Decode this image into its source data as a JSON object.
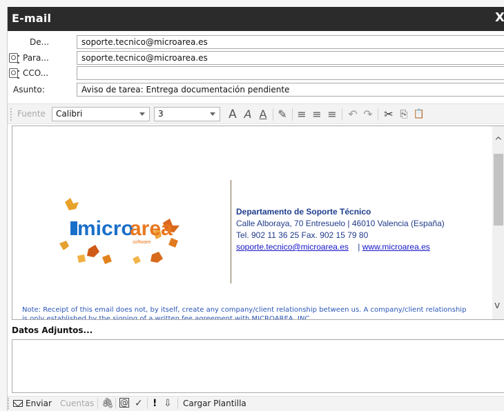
{
  "window": {
    "title": "E-mail",
    "close_glyph": "X"
  },
  "header": {
    "from": {
      "label": "De...",
      "value": "soporte.tecnico@microarea.es"
    },
    "to": {
      "label": "Para...",
      "value": "soporte.tecnico@microarea.es",
      "icon": "address-book-icon"
    },
    "bcc": {
      "label": "CCO...",
      "value": "",
      "icon": "address-book-icon"
    },
    "subject": {
      "label": "Asunto:",
      "value": "Aviso de tarea: Entrega documentación pendiente"
    }
  },
  "toolbar": {
    "font_label": "Fuente",
    "font_name": "Calibri",
    "font_size": "3",
    "glyphs": {
      "font_grow": "A",
      "font_italic": "A",
      "font_outline": "A",
      "highlighter": "✎",
      "align_left": "≡",
      "align_center": "≡",
      "align_right": "≡",
      "undo": "↶",
      "redo": "↷",
      "cut": "✂",
      "copy": "⎘",
      "paste": "📋"
    }
  },
  "body": {
    "logo_text": "microarea",
    "logo_sub": "software",
    "signature": {
      "department": "Departamento de Soporte Técnico",
      "address": "Calle Alboraya, 70 Entresuelo | 46010 Valencia (España)",
      "phone": "Tel. 902 11 36 25 Fax. 902 15 79 80",
      "email": "soporte.tecnico@microarea.es",
      "separator": "|",
      "web": "www.microarea.es"
    },
    "note_line1": "Note: Receipt of this email does not, by itself, create any company/client relationship between us.  A company/client relationship",
    "note_line2": "is only established by the signing of a written fee agreement with MICROAREA, INC."
  },
  "attachments": {
    "label": "Datos Adjuntos..."
  },
  "bottombar": {
    "send": "Enviar",
    "accounts": "Cuentas",
    "attach_glyph": "🖇",
    "check_glyph": "✓",
    "priority_glyph": "!",
    "down_glyph": "⇩",
    "template": "Cargar Plantilla"
  },
  "colors": {
    "titlebar": "#2b2b2b",
    "link": "#1515c8",
    "note": "#2a55b5",
    "logo_blue": "#1a6fc9",
    "logo_orange": "#e8771e"
  }
}
